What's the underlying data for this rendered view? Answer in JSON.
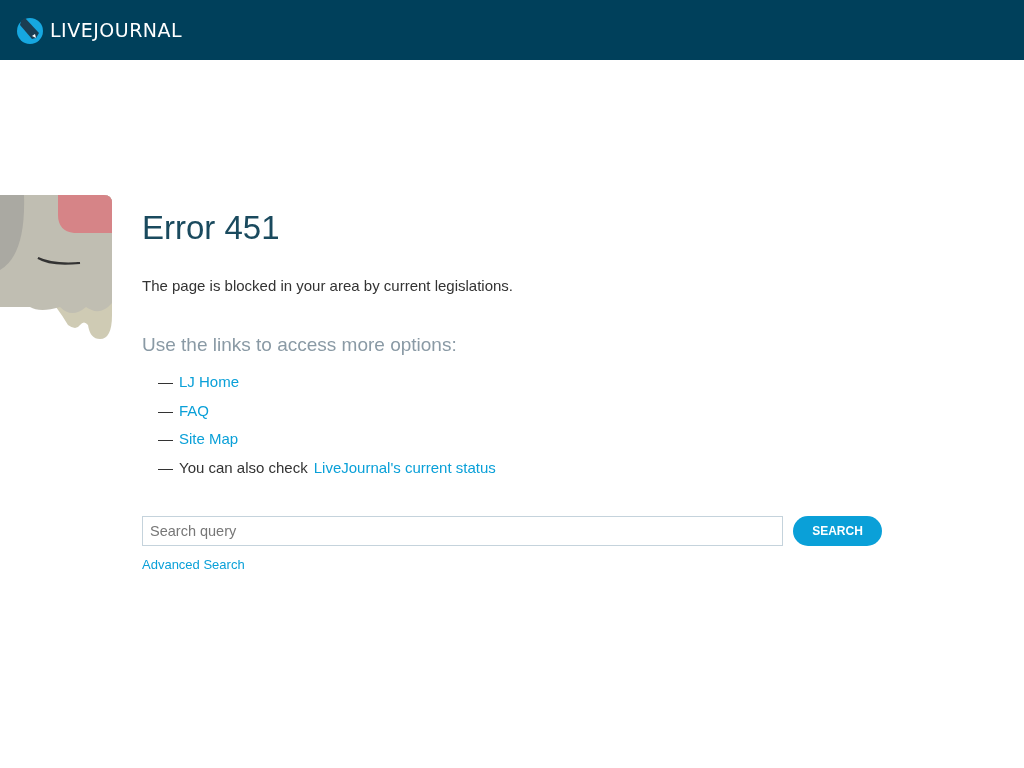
{
  "header": {
    "logo_text": "LIVEJOURNAL"
  },
  "error": {
    "title": "Error 451",
    "message": "The page is blocked in your area by current legislations."
  },
  "options": {
    "heading": "Use the links to access more options:",
    "items": [
      {
        "kind": "link",
        "marker": "—",
        "link": "LJ Home"
      },
      {
        "kind": "link",
        "marker": "—",
        "link": "FAQ"
      },
      {
        "kind": "link",
        "marker": "—",
        "link": "Site Map"
      },
      {
        "kind": "text_link",
        "marker": "—",
        "text": "You can also check",
        "link": "LiveJournal's current status"
      }
    ]
  },
  "search": {
    "placeholder": "Search query",
    "button": "SEARCH",
    "advanced_link": "Advanced Search"
  }
}
